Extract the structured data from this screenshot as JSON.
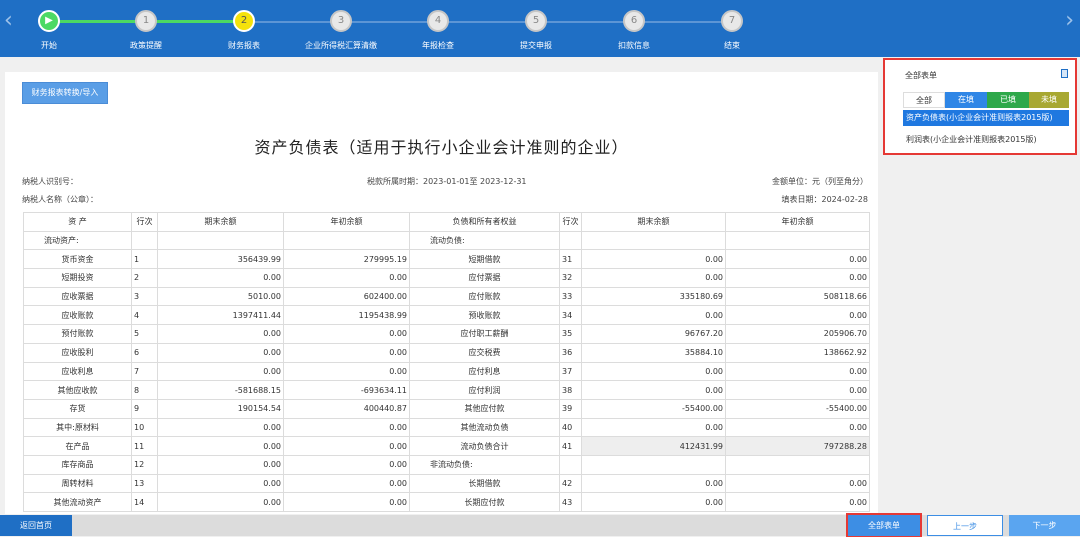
{
  "steps": [
    {
      "num": "▶",
      "label": "开始"
    },
    {
      "num": "1",
      "label": "政策提醒"
    },
    {
      "num": "2",
      "label": "财务报表"
    },
    {
      "num": "3",
      "label": "企业所得税汇算清缴"
    },
    {
      "num": "4",
      "label": "年报检查"
    },
    {
      "num": "5",
      "label": "提交申报"
    },
    {
      "num": "6",
      "label": "扣款信息"
    },
    {
      "num": "7",
      "label": "结束"
    }
  ],
  "nav": {
    "prev_icon": "‹",
    "next_icon": "›"
  },
  "toolbar": {
    "import_label": "财务报表转换/导入"
  },
  "report": {
    "title": "资产负债表（适用于执行小企业会计准则的企业）",
    "taxpayer_id_label": "纳税人识别号：",
    "period": "税款所属时期：2023-01-01至 2023-12-31",
    "unit": "金额单位：元（列至角分）",
    "taxpayer_name_label": "纳税人名称（公章）：",
    "fill_date": "填表日期：2024-02-28"
  },
  "table": {
    "headers": [
      "资 产",
      "行次",
      "期末余额",
      "年初余额",
      "负债和所有者权益",
      "行次",
      "期末余额",
      "年初余额"
    ],
    "rows": [
      [
        "流动资产:",
        "",
        "",
        "",
        "流动负债:",
        "",
        "",
        ""
      ],
      [
        "货币资金",
        "1",
        "356439.99",
        "279995.19",
        "短期借款",
        "31",
        "0.00",
        "0.00"
      ],
      [
        "短期投资",
        "2",
        "0.00",
        "0.00",
        "应付票据",
        "32",
        "0.00",
        "0.00"
      ],
      [
        "应收票据",
        "3",
        "5010.00",
        "602400.00",
        "应付账款",
        "33",
        "335180.69",
        "508118.66"
      ],
      [
        "应收账款",
        "4",
        "1397411.44",
        "1195438.99",
        "预收账款",
        "34",
        "0.00",
        "0.00"
      ],
      [
        "预付账款",
        "5",
        "0.00",
        "0.00",
        "应付职工薪酬",
        "35",
        "96767.20",
        "205906.70"
      ],
      [
        "应收股利",
        "6",
        "0.00",
        "0.00",
        "应交税费",
        "36",
        "35884.10",
        "138662.92"
      ],
      [
        "应收利息",
        "7",
        "0.00",
        "0.00",
        "应付利息",
        "37",
        "0.00",
        "0.00"
      ],
      [
        "其他应收款",
        "8",
        "-581688.15",
        "-693634.11",
        "应付利润",
        "38",
        "0.00",
        "0.00"
      ],
      [
        "存货",
        "9",
        "190154.54",
        "400440.87",
        "其他应付款",
        "39",
        "-55400.00",
        "-55400.00"
      ],
      [
        "其中:原材料",
        "10",
        "0.00",
        "0.00",
        "其他流动负债",
        "40",
        "0.00",
        "0.00"
      ],
      [
        "在产品",
        "11",
        "0.00",
        "0.00",
        "流动负债合计",
        "41",
        "412431.99",
        "797288.28"
      ],
      [
        "库存商品",
        "12",
        "0.00",
        "0.00",
        "非流动负债:",
        "",
        "",
        ""
      ],
      [
        "周转材料",
        "13",
        "0.00",
        "0.00",
        "长期借款",
        "42",
        "0.00",
        "0.00"
      ],
      [
        "其他流动资产",
        "14",
        "0.00",
        "0.00",
        "长期应付款",
        "43",
        "0.00",
        "0.00"
      ]
    ]
  },
  "side_panel": {
    "title": "全部表单",
    "filters": [
      "全部",
      "在填",
      "已填",
      "未填"
    ],
    "forms": [
      "资产负债表(小企业会计准则报表2015版)",
      "利润表(小企业会计准则报表2015版)"
    ]
  },
  "bottom": {
    "home": "返回首页",
    "all_forms": "全部表单",
    "prev": "上一步",
    "next": "下一步"
  },
  "colors": {
    "primary": "#1f6fc5",
    "progress_done": "#4cd964",
    "current_step": "#f5e20c",
    "highlight_border": "#e53935"
  }
}
